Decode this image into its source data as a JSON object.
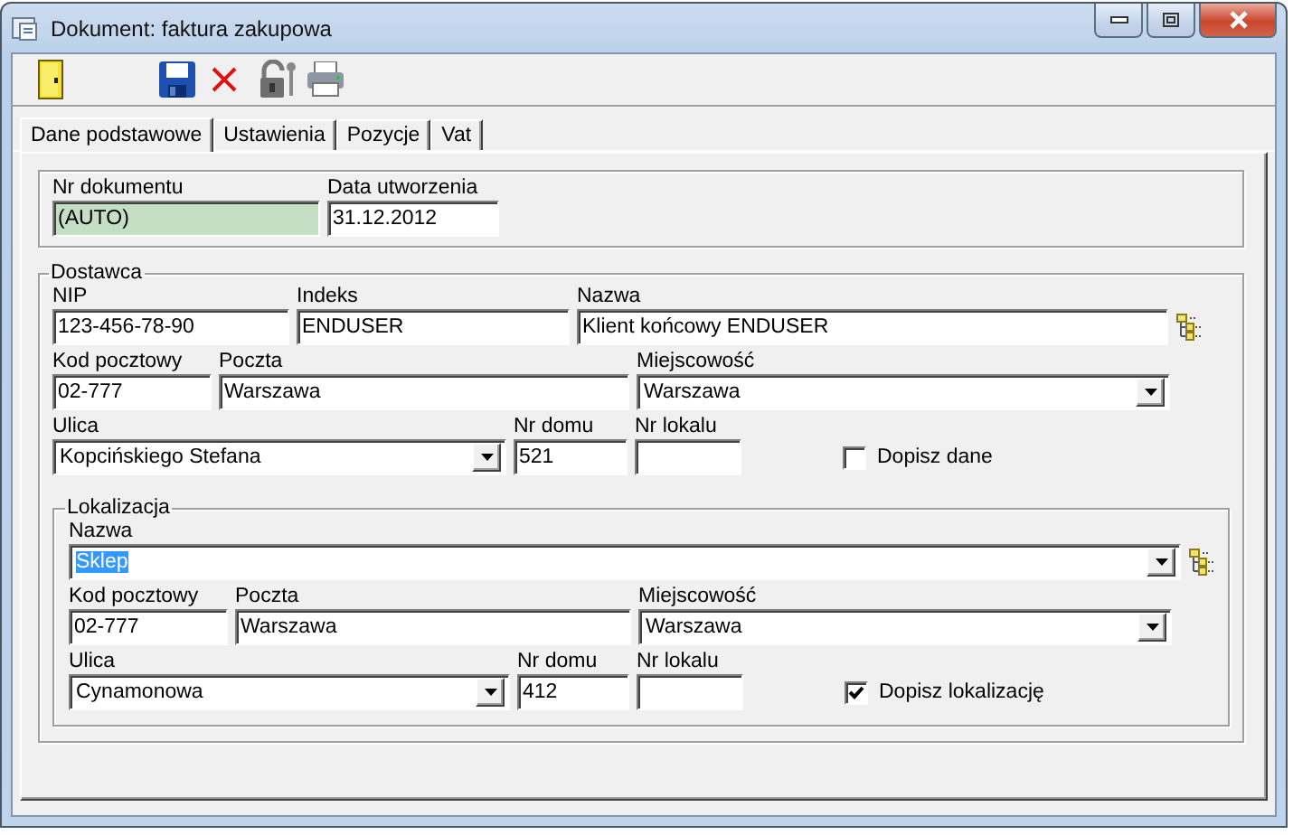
{
  "window": {
    "title": "Dokument: faktura zakupowa"
  },
  "tabs": [
    {
      "label": "Dane podstawowe",
      "selected": true
    },
    {
      "label": "Ustawienia",
      "selected": false
    },
    {
      "label": "Pozycje",
      "selected": false
    },
    {
      "label": "Vat",
      "selected": false
    }
  ],
  "header": {
    "fields": [
      {
        "label": "Nr dokumentu",
        "value": "(AUTO)",
        "readonly": true
      },
      {
        "label": "Data utworzenia",
        "value": "31.12.2012",
        "readonly": false
      }
    ]
  },
  "dostawca": {
    "title": "Dostawca",
    "rows": [
      [
        {
          "kind": "text",
          "label": "NIP",
          "value": "123-456-78-90"
        },
        {
          "kind": "text",
          "label": "Indeks",
          "value": "ENDUSER"
        },
        {
          "kind": "picker",
          "label": "Nazwa",
          "value": "Klient końcowy ENDUSER"
        }
      ],
      [
        {
          "kind": "text",
          "label": "Kod pocztowy",
          "value": "02-777"
        },
        {
          "kind": "text",
          "label": "Poczta",
          "value": "Warszawa"
        },
        {
          "kind": "combo",
          "label": "Miejscowość",
          "value": "Warszawa"
        }
      ],
      [
        {
          "kind": "combo",
          "label": "Ulica",
          "value": "Kopcińskiego Stefana"
        },
        {
          "kind": "text",
          "label": "Nr domu",
          "value": "521"
        },
        {
          "kind": "text",
          "label": "Nr lokalu"
        }
      ]
    ],
    "checkbox": {
      "label": "Dopisz dane",
      "checked": false
    },
    "lokalizacja": {
      "title": "Lokalizacja",
      "name": {
        "label": "Nazwa",
        "value": "Sklep",
        "text_selected": true
      },
      "rows": [
        [
          {
            "kind": "text",
            "label": "Kod pocztowy",
            "value": "02-777"
          },
          {
            "kind": "text",
            "label": "Poczta",
            "value": "Warszawa"
          },
          {
            "kind": "combo",
            "label": "Miejscowość",
            "value": "Warszawa"
          }
        ],
        [
          {
            "kind": "combo",
            "label": "Ulica",
            "value": "Cynamonowa"
          },
          {
            "kind": "text",
            "label": "Nr domu",
            "value": "412"
          },
          {
            "kind": "text",
            "label": "Nr lokalu"
          }
        ]
      ],
      "checkbox": {
        "label": "Dopisz lokalizację",
        "checked": true
      }
    }
  }
}
